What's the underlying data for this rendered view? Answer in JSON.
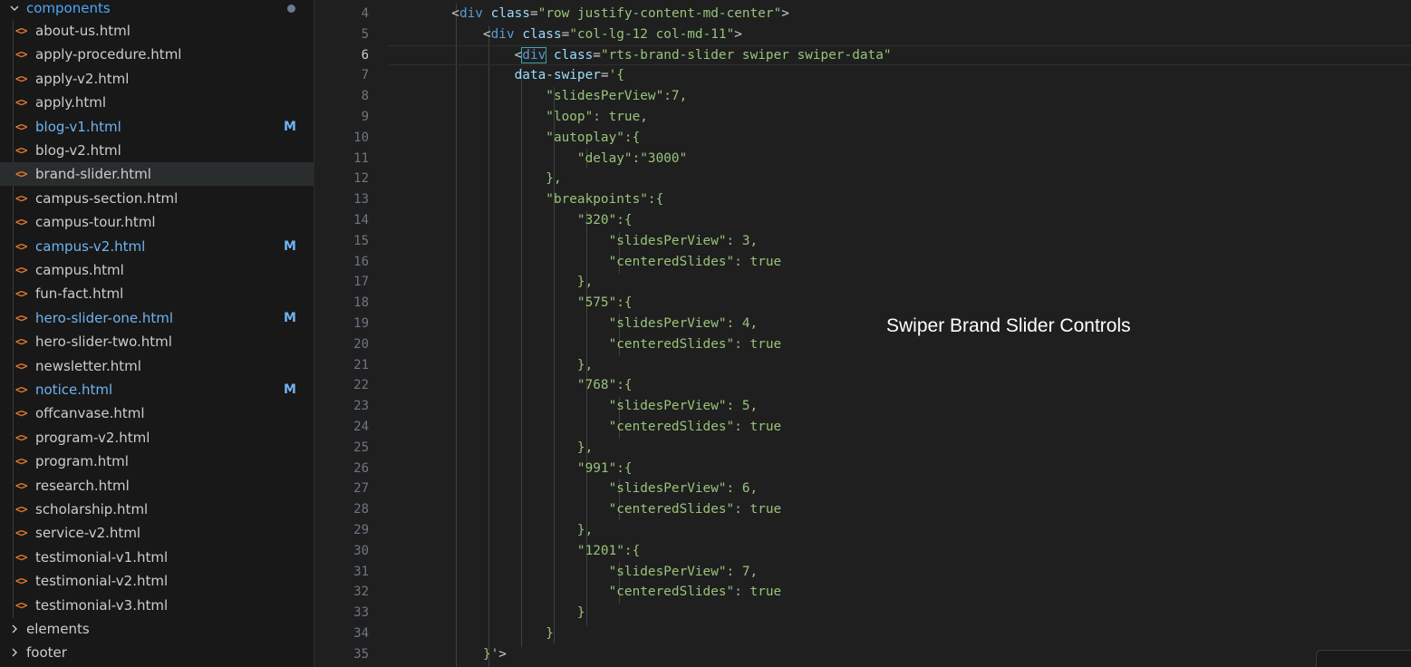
{
  "explorer": {
    "open_folder": "components",
    "files": [
      {
        "name": "about-us.html",
        "modified": false,
        "selected": false
      },
      {
        "name": "apply-procedure.html",
        "modified": false,
        "selected": false
      },
      {
        "name": "apply-v2.html",
        "modified": false,
        "selected": false
      },
      {
        "name": "apply.html",
        "modified": false,
        "selected": false
      },
      {
        "name": "blog-v1.html",
        "modified": true,
        "selected": false
      },
      {
        "name": "blog-v2.html",
        "modified": false,
        "selected": false
      },
      {
        "name": "brand-slider.html",
        "modified": false,
        "selected": true
      },
      {
        "name": "campus-section.html",
        "modified": false,
        "selected": false
      },
      {
        "name": "campus-tour.html",
        "modified": false,
        "selected": false
      },
      {
        "name": "campus-v2.html",
        "modified": true,
        "selected": false
      },
      {
        "name": "campus.html",
        "modified": false,
        "selected": false
      },
      {
        "name": "fun-fact.html",
        "modified": false,
        "selected": false
      },
      {
        "name": "hero-slider-one.html",
        "modified": true,
        "selected": false
      },
      {
        "name": "hero-slider-two.html",
        "modified": false,
        "selected": false
      },
      {
        "name": "newsletter.html",
        "modified": false,
        "selected": false
      },
      {
        "name": "notice.html",
        "modified": true,
        "selected": false
      },
      {
        "name": "offcanvase.html",
        "modified": false,
        "selected": false
      },
      {
        "name": "program-v2.html",
        "modified": false,
        "selected": false
      },
      {
        "name": "program.html",
        "modified": false,
        "selected": false
      },
      {
        "name": "research.html",
        "modified": false,
        "selected": false
      },
      {
        "name": "scholarship.html",
        "modified": false,
        "selected": false
      },
      {
        "name": "service-v2.html",
        "modified": false,
        "selected": false
      },
      {
        "name": "testimonial-v1.html",
        "modified": false,
        "selected": false
      },
      {
        "name": "testimonial-v2.html",
        "modified": false,
        "selected": false
      },
      {
        "name": "testimonial-v3.html",
        "modified": false,
        "selected": false
      }
    ],
    "modified_badge": "M",
    "file_icon": "<>",
    "collapsed_folders": [
      "elements",
      "footer"
    ]
  },
  "editor": {
    "active_line": 6,
    "lines": [
      {
        "n": 4,
        "tokens": [
          [
            "p",
            "        <"
          ],
          [
            "t",
            "div"
          ],
          [
            "p",
            " "
          ],
          [
            "a",
            "class"
          ],
          [
            "p",
            "="
          ],
          [
            "s",
            "\"row justify-content-md-center\""
          ],
          [
            "p",
            ">"
          ]
        ]
      },
      {
        "n": 5,
        "tokens": [
          [
            "p",
            "            <"
          ],
          [
            "t",
            "div"
          ],
          [
            "p",
            " "
          ],
          [
            "a",
            "class"
          ],
          [
            "p",
            "="
          ],
          [
            "s",
            "\"col-lg-12 col-md-11\""
          ],
          [
            "p",
            ">"
          ]
        ]
      },
      {
        "n": 6,
        "tokens": [
          [
            "p",
            "                <"
          ],
          [
            "th",
            "div"
          ],
          [
            "p",
            " "
          ],
          [
            "a",
            "class"
          ],
          [
            "p",
            "="
          ],
          [
            "s",
            "\"rts-brand-slider swiper swiper-data\""
          ]
        ]
      },
      {
        "n": 7,
        "tokens": [
          [
            "p",
            "                "
          ],
          [
            "a",
            "data-swiper"
          ],
          [
            "p",
            "="
          ],
          [
            "s",
            "'{"
          ]
        ]
      },
      {
        "n": 8,
        "tokens": [
          [
            "g",
            "                    \"slidesPerView\":7,"
          ]
        ]
      },
      {
        "n": 9,
        "tokens": [
          [
            "g",
            "                    \"loop\": true,"
          ]
        ]
      },
      {
        "n": 10,
        "tokens": [
          [
            "g",
            "                    \"autoplay\":{"
          ]
        ]
      },
      {
        "n": 11,
        "tokens": [
          [
            "g",
            "                        \"delay\":\"3000\""
          ]
        ]
      },
      {
        "n": 12,
        "tokens": [
          [
            "g",
            "                    },"
          ]
        ]
      },
      {
        "n": 13,
        "tokens": [
          [
            "g",
            "                    \"breakpoints\":{"
          ]
        ]
      },
      {
        "n": 14,
        "tokens": [
          [
            "g",
            "                        \"320\":{"
          ]
        ]
      },
      {
        "n": 15,
        "tokens": [
          [
            "g",
            "                            \"slidesPerView\": 3,"
          ]
        ]
      },
      {
        "n": 16,
        "tokens": [
          [
            "g",
            "                            \"centeredSlides\": true"
          ]
        ]
      },
      {
        "n": 17,
        "tokens": [
          [
            "g",
            "                        },"
          ]
        ]
      },
      {
        "n": 18,
        "tokens": [
          [
            "g",
            "                        \"575\":{"
          ]
        ]
      },
      {
        "n": 19,
        "tokens": [
          [
            "g",
            "                            \"slidesPerView\": 4,"
          ]
        ]
      },
      {
        "n": 20,
        "tokens": [
          [
            "g",
            "                            \"centeredSlides\": true"
          ]
        ]
      },
      {
        "n": 21,
        "tokens": [
          [
            "g",
            "                        },"
          ]
        ]
      },
      {
        "n": 22,
        "tokens": [
          [
            "g",
            "                        \"768\":{"
          ]
        ]
      },
      {
        "n": 23,
        "tokens": [
          [
            "g",
            "                            \"slidesPerView\": 5,"
          ]
        ]
      },
      {
        "n": 24,
        "tokens": [
          [
            "g",
            "                            \"centeredSlides\": true"
          ]
        ]
      },
      {
        "n": 25,
        "tokens": [
          [
            "g",
            "                        },"
          ]
        ]
      },
      {
        "n": 26,
        "tokens": [
          [
            "g",
            "                        \"991\":{"
          ]
        ]
      },
      {
        "n": 27,
        "tokens": [
          [
            "g",
            "                            \"slidesPerView\": 6,"
          ]
        ]
      },
      {
        "n": 28,
        "tokens": [
          [
            "g",
            "                            \"centeredSlides\": true"
          ]
        ]
      },
      {
        "n": 29,
        "tokens": [
          [
            "g",
            "                        },"
          ]
        ]
      },
      {
        "n": 30,
        "tokens": [
          [
            "g",
            "                        \"1201\":{"
          ]
        ]
      },
      {
        "n": 31,
        "tokens": [
          [
            "g",
            "                            \"slidesPerView\": 7,"
          ]
        ]
      },
      {
        "n": 32,
        "tokens": [
          [
            "g",
            "                            \"centeredSlides\": true"
          ]
        ]
      },
      {
        "n": 33,
        "tokens": [
          [
            "g",
            "                        }"
          ]
        ]
      },
      {
        "n": 34,
        "tokens": [
          [
            "g",
            "                    }"
          ]
        ]
      },
      {
        "n": 35,
        "tokens": [
          [
            "g",
            "            }'"
          ],
          [
            "p",
            ">"
          ]
        ]
      }
    ]
  },
  "overlay": {
    "caption": "Swiper Brand Slider Controls"
  },
  "colors": {
    "folder_open": "#4fa6f8",
    "modified": "#6fb3f2",
    "html_icon": "#e37933",
    "json_green": "#98c379"
  }
}
